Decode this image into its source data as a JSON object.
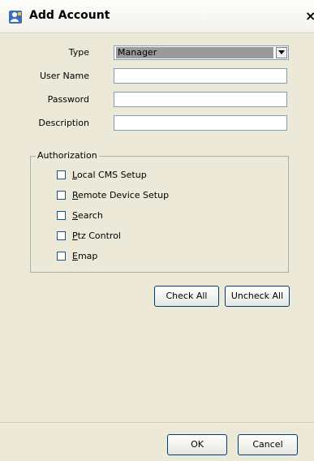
{
  "window": {
    "title": "Add Account",
    "close_glyph": "×",
    "icon": "user-icon"
  },
  "form": {
    "type_label": "Type",
    "type_value": "Manager",
    "user_name_label": "User Name",
    "user_name_value": "",
    "password_label": "Password",
    "password_value": "",
    "description_label": "Description",
    "description_value": ""
  },
  "authorization": {
    "legend": "Authorization",
    "items": [
      {
        "first": "L",
        "rest": "ocal CMS Setup",
        "checked": false
      },
      {
        "first": "R",
        "rest": "emote Device Setup",
        "checked": false
      },
      {
        "first": "S",
        "rest": "earch",
        "checked": false
      },
      {
        "first": "P",
        "rest": "tz Control",
        "checked": false
      },
      {
        "first": "E",
        "rest": "map",
        "checked": false
      }
    ]
  },
  "buttons": {
    "check_all": "Check All",
    "uncheck_all": "Uncheck All",
    "ok": "OK",
    "cancel": "Cancel"
  }
}
